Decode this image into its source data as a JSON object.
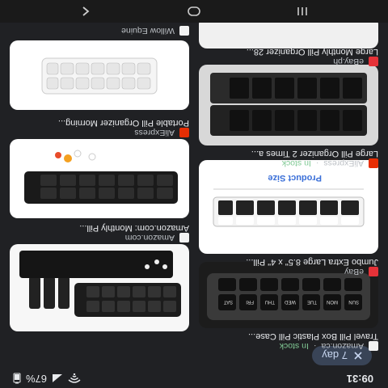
{
  "status_bar": {
    "time": "09:31",
    "battery": "67%"
  },
  "filter_chip": {
    "label": "7 day"
  },
  "results": [
    {
      "title": "Travel Pill Box Plastic Pill Case...",
      "source": "Amazon.ca",
      "stock": "In stock",
      "fav_color": "#f2f2f2"
    },
    {
      "title": "Jumbo Extra Large 8.5\" x 4\" Pill...",
      "source": "eBay",
      "stock": "",
      "fav_color": "#e53238"
    },
    {
      "title": "Amazon.com: Monthly Pill...",
      "source": "Amazon.com",
      "stock": "",
      "fav_color": "#f2f2f2"
    },
    {
      "title": "Large Pill Organizer 2 Times a...",
      "source": "AliExpress",
      "stock": "In stock",
      "fav_color": "#e62e04"
    },
    {
      "title": "Portable Pill Organizer Morning...",
      "source": "AliExpress",
      "stock": "",
      "fav_color": "#e62e04"
    },
    {
      "title": "Large Monthly Pill Organizer 28...",
      "source": "eBay.ph",
      "stock": "",
      "fav_color": "#e53238"
    },
    {
      "title": "",
      "source": "Willow Equine",
      "stock": "",
      "fav_color": "#f2f2f2"
    }
  ],
  "product_size_label": "Product Size",
  "nav": [
    "back",
    "home",
    "recents"
  ],
  "icons": {
    "back": "chevron-left-icon",
    "home": "circle-home-icon",
    "recents": "recents-icon",
    "close": "close-icon",
    "wifi": "wifi-icon",
    "signal": "signal-icon",
    "battery": "battery-icon"
  }
}
